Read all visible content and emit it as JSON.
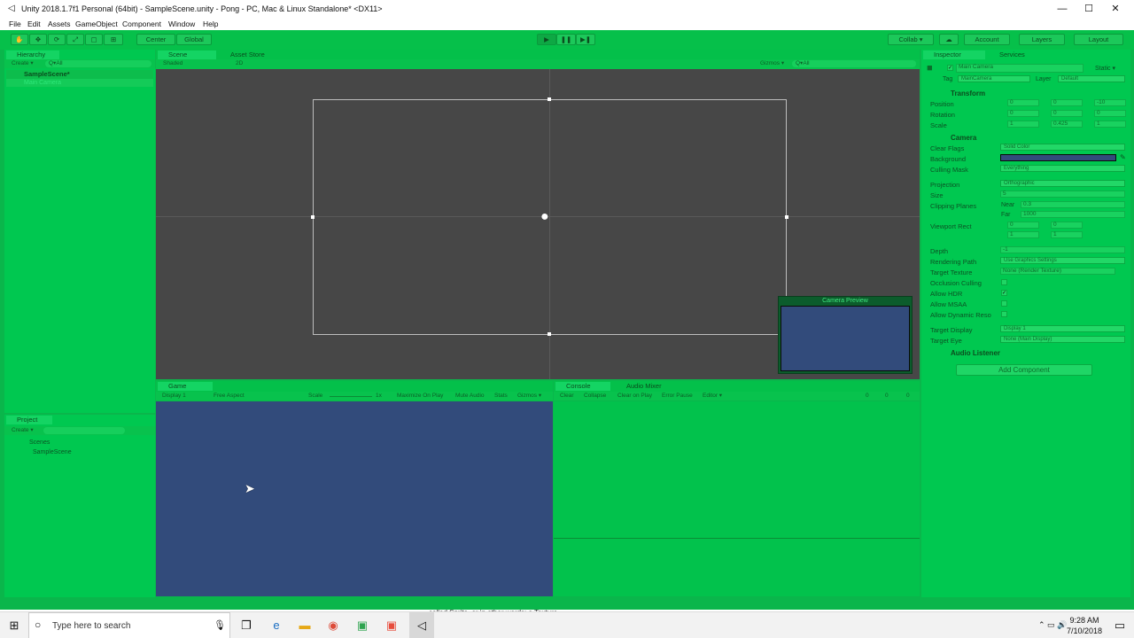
{
  "window": {
    "title": "Unity 2018.1.7f1 Personal (64bit) - SampleScene.unity - Pong - PC, Mac & Linux Standalone* <DX11>",
    "minimize": "—",
    "maximize": "☐",
    "close": "✕"
  },
  "menu": [
    "File",
    "Edit",
    "Assets",
    "GameObject",
    "Component",
    "Window",
    "Help"
  ],
  "toolbar": {
    "tools": [
      "✋",
      "✥",
      "⟳",
      "⤢",
      "▢",
      "⊞"
    ],
    "pivot": "Center",
    "space": "Global",
    "play": "▶",
    "pause": "❚❚",
    "step": "▶❚",
    "collab": "Collab ▾",
    "cloud": "☁",
    "account": "Account",
    "layers": "Layers",
    "layout": "Layout"
  },
  "hierarchy": {
    "tab": "Hierarchy",
    "create": "Create ▾",
    "search": "Q▾All",
    "scene": "SampleScene*",
    "items": [
      "Main Camera"
    ]
  },
  "scene": {
    "tab": "Scene",
    "tab2": "Asset Store",
    "shading": "Shaded",
    "mode2d": "2D",
    "gizmos": "Gizmos ▾",
    "search": "Q▾All",
    "camera_icon": "camera-gizmo"
  },
  "camera_preview": {
    "title": "Camera Preview"
  },
  "game": {
    "tab": "Game",
    "display": "Display 1",
    "aspect": "Free Aspect",
    "scale_label": "Scale",
    "scale_value": "1x",
    "maximize": "Maximize On Play",
    "mute": "Mute Audio",
    "stats": "Stats",
    "gizmos": "Gizmos ▾",
    "bg": "#324b7b"
  },
  "console": {
    "tab": "Console",
    "tab2": "Audio Mixer",
    "clear": "Clear",
    "collapse": "Collapse",
    "clear_on_play": "Clear on Play",
    "error_pause": "Error Pause",
    "editor": "Editor ▾",
    "c1": "0",
    "c2": "0",
    "c3": "0"
  },
  "project": {
    "tab": "Project",
    "create": "Create ▾",
    "folder": "Scenes",
    "file": "SampleScene"
  },
  "inspector": {
    "tab": "Inspector",
    "tab2": "Services",
    "name": "Main Camera",
    "static": "Static ▾",
    "tag_label": "Tag",
    "tag": "MainCamera",
    "layer_label": "Layer",
    "layer": "Default",
    "transform": "Transform",
    "position": {
      "label": "Position",
      "x": "0",
      "y": "0",
      "z": "-10"
    },
    "rotation": {
      "label": "Rotation",
      "x": "0",
      "y": "0",
      "z": "0"
    },
    "scale": {
      "label": "Scale",
      "x": "1",
      "y": "0.425",
      "z": "1"
    },
    "camera": "Camera",
    "clear_flags": {
      "label": "Clear Flags",
      "value": "Solid Color"
    },
    "background": {
      "label": "Background",
      "color": "#324b7b"
    },
    "culling_mask": {
      "label": "Culling Mask",
      "value": "Everything"
    },
    "projection": {
      "label": "Projection",
      "value": "Orthographic"
    },
    "size": {
      "label": "Size",
      "value": "5"
    },
    "clipping": {
      "label": "Clipping Planes",
      "near_label": "Near",
      "near": "0.3",
      "far_label": "Far",
      "far": "1000"
    },
    "viewport": {
      "label": "Viewport Rect",
      "x": "0",
      "y": "0",
      "w": "1",
      "h": "1"
    },
    "depth": {
      "label": "Depth",
      "value": "-1"
    },
    "rendering_path": {
      "label": "Rendering Path",
      "value": "Use Graphics Settings"
    },
    "target_texture": {
      "label": "Target Texture",
      "value": "None (Render Texture)"
    },
    "occlusion": "Occlusion Culling",
    "hdr": "Allow HDR",
    "msaa": "Allow MSAA",
    "dynres": "Allow Dynamic Reso",
    "target_display": {
      "label": "Target Display",
      "value": "Display 1"
    },
    "target_eye": {
      "label": "Target Eye",
      "value": "None (Main Display)"
    },
    "audio_listener": "Audio Listener",
    "add_component": "Add Component"
  },
  "status": {
    "text": "called Sprite, or in other words: a Texture"
  },
  "taskbar": {
    "search": "Type here to search",
    "time": "9:28 AM",
    "date": "7/10/2018"
  }
}
